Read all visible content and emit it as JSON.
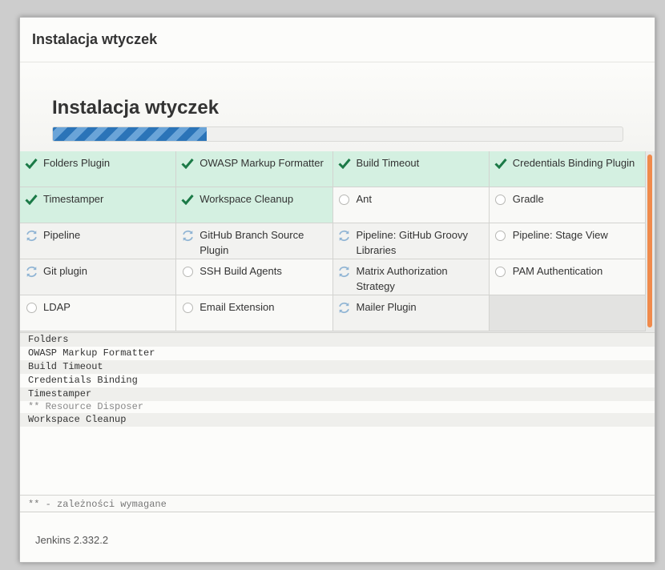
{
  "dialog": {
    "title": "Instalacja wtyczek",
    "section_title": "Instalacja wtyczek",
    "progress_fraction": 0.27
  },
  "plugins": [
    {
      "name": "Folders Plugin",
      "status": "installed"
    },
    {
      "name": "OWASP Markup Formatter",
      "status": "installed"
    },
    {
      "name": "Build Timeout",
      "status": "installed"
    },
    {
      "name": "Credentials Binding Plugin",
      "status": "installed"
    },
    {
      "name": "Timestamper",
      "status": "installed"
    },
    {
      "name": "Workspace Cleanup",
      "status": "installed"
    },
    {
      "name": "Ant",
      "status": "pending"
    },
    {
      "name": "Gradle",
      "status": "pending"
    },
    {
      "name": "Pipeline",
      "status": "installing"
    },
    {
      "name": "GitHub Branch Source Plugin",
      "status": "installing"
    },
    {
      "name": "Pipeline: GitHub Groovy Libraries",
      "status": "installing"
    },
    {
      "name": "Pipeline: Stage View",
      "status": "pending"
    },
    {
      "name": "Git plugin",
      "status": "installing"
    },
    {
      "name": "SSH Build Agents",
      "status": "pending"
    },
    {
      "name": "Matrix Authorization Strategy",
      "status": "installing"
    },
    {
      "name": "PAM Authentication",
      "status": "pending"
    },
    {
      "name": "LDAP",
      "status": "pending"
    },
    {
      "name": "Email Extension",
      "status": "pending"
    },
    {
      "name": "Mailer Plugin",
      "status": "installing"
    }
  ],
  "status_icons": {
    "installed": "checkmark-icon",
    "installing": "refresh-icon",
    "pending": "circle-icon"
  },
  "colors": {
    "installed_bg": "#d4f0e1",
    "check": "#1b7a47",
    "progress": "#2b74b8",
    "scrollbar": "#f08a4b"
  },
  "log": [
    {
      "text": "Folders",
      "dependency": false
    },
    {
      "text": "OWASP Markup Formatter",
      "dependency": false
    },
    {
      "text": "Build Timeout",
      "dependency": false
    },
    {
      "text": "Credentials Binding",
      "dependency": false
    },
    {
      "text": "Timestamper",
      "dependency": false
    },
    {
      "text": "** Resource Disposer",
      "dependency": true
    },
    {
      "text": "Workspace Cleanup",
      "dependency": false
    }
  ],
  "legend": "** - zależności wymagane",
  "footer": {
    "version": "Jenkins 2.332.2"
  }
}
